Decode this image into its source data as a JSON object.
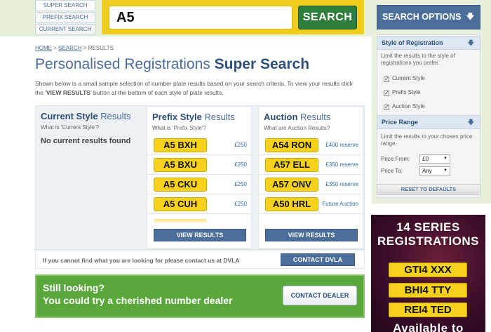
{
  "tabs": [
    "SUPER SEARCH",
    "PREFIX SEARCH",
    "CURRENT SEARCH"
  ],
  "search": {
    "value": "A5",
    "button": "SEARCH"
  },
  "breadcrumb": {
    "home": "HOME",
    "search": "SEARCH",
    "current": "RESULTS",
    "sep": ">"
  },
  "title": {
    "light": "Personalised Registrations",
    "bold": "Super Search"
  },
  "intro": {
    "text1": "Shown below is a small sample selection of number plate results based on your search criteria. To view your results click the '",
    "bold": "VIEW RESULTS",
    "text2": "' button at the bottom of each style of plate results."
  },
  "columns": {
    "current": {
      "bold": "Current Style",
      "light": "Results",
      "sub": "What is 'Current Style'?",
      "empty": "No current results found"
    },
    "prefix": {
      "bold": "Prefix Style",
      "light": "Results",
      "sub": "What is 'Prefix Style'?",
      "rows": [
        {
          "plate": "A5 BXH",
          "price": "£250"
        },
        {
          "plate": "A5 BXU",
          "price": "£250"
        },
        {
          "plate": "A5 CKU",
          "price": "£250"
        },
        {
          "plate": "A5 CUH",
          "price": "£250"
        }
      ],
      "button": "VIEW RESULTS"
    },
    "auction": {
      "bold": "Auction",
      "light": "Results",
      "sub": "What are Auction Results?",
      "rows": [
        {
          "plate": "A54 RON",
          "price": "£400 reserve"
        },
        {
          "plate": "A57 ELL",
          "price": "£350 reserve"
        },
        {
          "plate": "A57 ONV",
          "price": "£350 reserve"
        },
        {
          "plate": "A50 HRL",
          "price": "Future Auction"
        }
      ],
      "button": "VIEW RESULTS"
    }
  },
  "dvla": {
    "text": "If you cannot find what you are looking for please contact us at DVLA",
    "button": "CONTACT DVLA"
  },
  "still": {
    "line1": "Still looking?",
    "line2": "You could try a cherished number dealer",
    "button": "CONTACT DEALER"
  },
  "sidebar": {
    "header": "SEARCH OPTIONS",
    "style": {
      "heading": "Style of Registration",
      "text": "Limit the results to the style of registrations you prefer.",
      "options": [
        {
          "label": "Current Style",
          "checked": true
        },
        {
          "label": "Prefix Style",
          "checked": true
        },
        {
          "label": "Auction Style",
          "checked": true
        }
      ]
    },
    "price": {
      "heading": "Price Range",
      "text": "Limit the results to your chosen price range.",
      "from_label": "Price From:",
      "from_value": "£0",
      "to_label": "Price To:",
      "to_value": "Any"
    },
    "reset": "RESET TO DEFAULTS"
  },
  "ad": {
    "line1": "14 SERIES",
    "line2": "REGISTRATIONS",
    "plates": [
      "GTI4 XXX",
      "BHI4 TTY",
      "REI4 TED"
    ],
    "footer": "Available to"
  },
  "icons": {
    "arrow": "down-arrow-icon",
    "check": "checkmark-icon"
  },
  "colors": {
    "brand_blue": "#4a6d9a",
    "plate_yellow": "#f7d21c",
    "search_green": "#2f7d3a",
    "banner_green": "#5aa83c"
  }
}
